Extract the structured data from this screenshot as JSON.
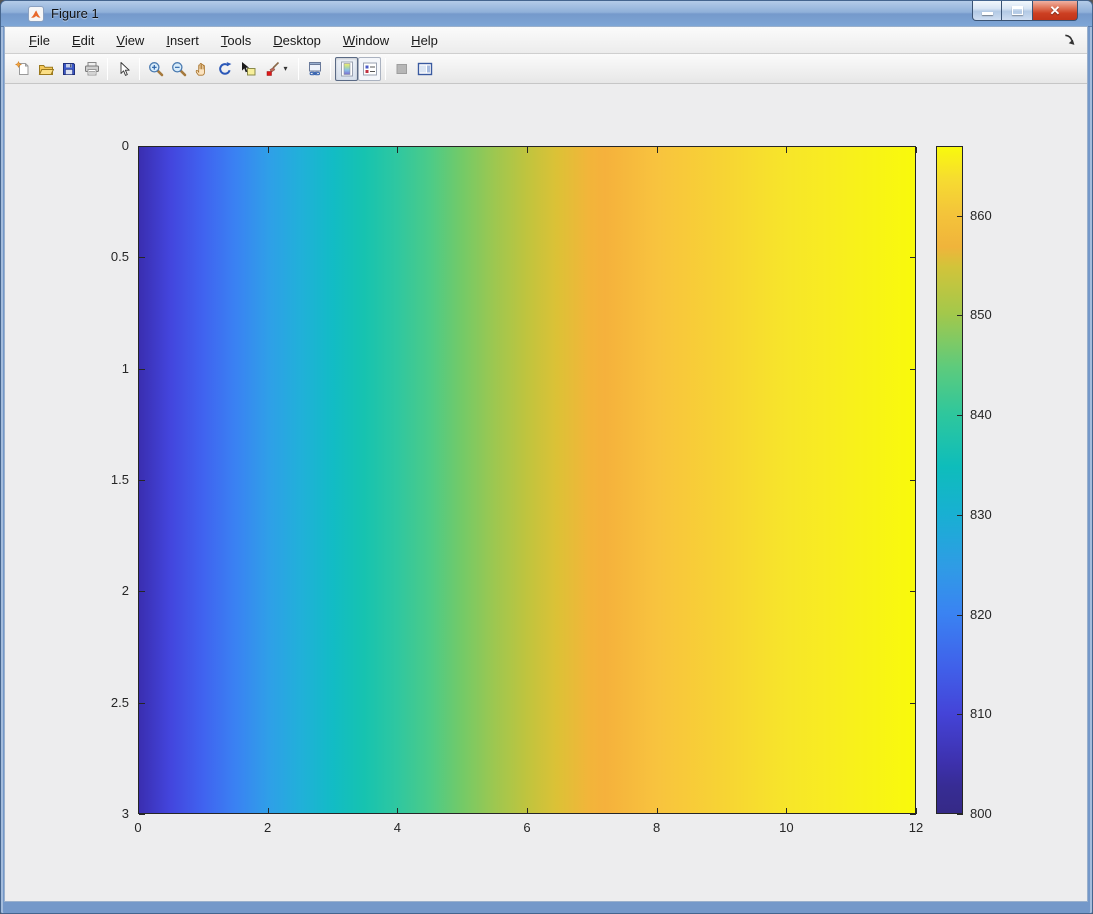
{
  "window": {
    "title": "Figure 1",
    "controls": {
      "minimize": "minimize",
      "maximize": "maximize",
      "close": "close",
      "close_glyph": "✕"
    }
  },
  "menu": {
    "items": [
      "File",
      "Edit",
      "View",
      "Insert",
      "Tools",
      "Desktop",
      "Window",
      "Help"
    ]
  },
  "toolbar": {
    "buttons": [
      {
        "name": "new-figure"
      },
      {
        "name": "open-file"
      },
      {
        "name": "save-figure"
      },
      {
        "name": "print-figure"
      },
      {
        "sep": true
      },
      {
        "name": "edit-plot"
      },
      {
        "sep": true
      },
      {
        "name": "zoom-in"
      },
      {
        "name": "zoom-out"
      },
      {
        "name": "pan"
      },
      {
        "name": "rotate-3d"
      },
      {
        "name": "data-cursor"
      },
      {
        "name": "brush-data",
        "dropdown": true
      },
      {
        "sep": true
      },
      {
        "name": "link-plot"
      },
      {
        "sep": true
      },
      {
        "name": "insert-colorbar",
        "pressed": true
      },
      {
        "name": "insert-legend",
        "framed": true
      },
      {
        "sep": true
      },
      {
        "name": "hide-plot-tools",
        "disabled": true
      },
      {
        "name": "show-plot-tools-dock"
      }
    ]
  },
  "chart_data": {
    "type": "heatmap",
    "title": "",
    "xlabel": "",
    "ylabel": "",
    "x_range": [
      0,
      12
    ],
    "x_ticks": [
      0,
      2,
      4,
      6,
      8,
      10,
      12
    ],
    "y_range": [
      0,
      3
    ],
    "y_ticks": [
      0,
      0.5,
      1,
      1.5,
      2,
      2.5,
      3
    ],
    "y_axis_reversed": true,
    "colormap": "parula",
    "axis_color": "#262626",
    "background_color": "#ededee",
    "colorbar": {
      "min": 800,
      "max": 867,
      "ticks": [
        800,
        810,
        820,
        830,
        840,
        850,
        860
      ]
    },
    "values_constant_in_y": true,
    "profile_x": [
      0,
      1,
      2,
      3,
      4,
      5,
      6,
      7,
      8,
      9,
      10,
      11,
      12
    ],
    "profile_values": [
      801,
      814,
      825,
      834,
      841,
      847,
      852,
      856.5,
      860,
      862.5,
      864.5,
      866,
      867
    ],
    "plot_gradient": [
      {
        "p": 0,
        "c": "#3a2eb0"
      },
      {
        "p": 4,
        "c": "#4345dd"
      },
      {
        "p": 8.3,
        "c": "#4063f0"
      },
      {
        "p": 12.5,
        "c": "#3a82f2"
      },
      {
        "p": 16.7,
        "c": "#2f9fe8"
      },
      {
        "p": 20.8,
        "c": "#21b0d9"
      },
      {
        "p": 25,
        "c": "#12bcc5"
      },
      {
        "p": 29,
        "c": "#16c3b0"
      },
      {
        "p": 33.3,
        "c": "#2fc7a0"
      },
      {
        "p": 37.5,
        "c": "#4ccb88"
      },
      {
        "p": 41.7,
        "c": "#74ca67"
      },
      {
        "p": 45.8,
        "c": "#9dc750"
      },
      {
        "p": 50,
        "c": "#c0c43e"
      },
      {
        "p": 54,
        "c": "#ddc136"
      },
      {
        "p": 58,
        "c": "#f2b53a"
      },
      {
        "p": 60,
        "c": "#f5b13c"
      },
      {
        "p": 66.7,
        "c": "#f8c33e"
      },
      {
        "p": 75,
        "c": "#f7d334"
      },
      {
        "p": 83.3,
        "c": "#f7e52a"
      },
      {
        "p": 91.7,
        "c": "#f8f01c"
      },
      {
        "p": 100,
        "c": "#f9fa0b"
      }
    ],
    "colorbar_gradient": [
      {
        "p": 0,
        "c": "#352a87"
      },
      {
        "p": 4,
        "c": "#372c94"
      },
      {
        "p": 7.5,
        "c": "#3d31ad"
      },
      {
        "p": 15,
        "c": "#4444d8"
      },
      {
        "p": 22,
        "c": "#4061ea"
      },
      {
        "p": 30,
        "c": "#3a83f2"
      },
      {
        "p": 37,
        "c": "#2f9ce5"
      },
      {
        "p": 45,
        "c": "#18b0d2"
      },
      {
        "p": 52,
        "c": "#0ebdbb"
      },
      {
        "p": 60,
        "c": "#2fc79c"
      },
      {
        "p": 67,
        "c": "#5ecb7c"
      },
      {
        "p": 75,
        "c": "#a3c84b"
      },
      {
        "p": 82,
        "c": "#d2c43a"
      },
      {
        "p": 85,
        "c": "#f0b43b"
      },
      {
        "p": 90,
        "c": "#f4c43a"
      },
      {
        "p": 95,
        "c": "#f6db31"
      },
      {
        "p": 100,
        "c": "#f9f90d"
      }
    ]
  }
}
